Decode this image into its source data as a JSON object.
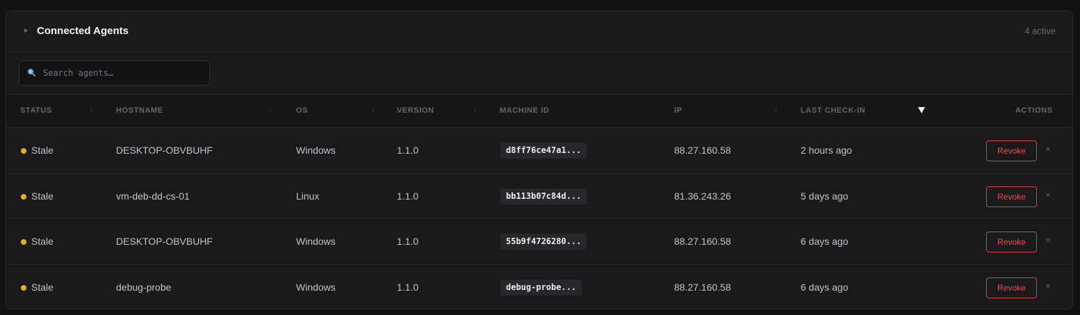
{
  "panel": {
    "title": "Connected Agents",
    "active_count": "4 active"
  },
  "search": {
    "placeholder": "Search agents…",
    "value": ""
  },
  "table": {
    "columns": [
      "STATUS",
      "HOSTNAME",
      "OS",
      "VERSION",
      "MACHINE ID",
      "IP",
      "LAST CHECK-IN",
      "ACTIONS"
    ],
    "sorted_column": "LAST CHECK-IN",
    "sort_direction": "descending",
    "rows": [
      {
        "status": "Stale",
        "hostname": "DESKTOP-OBVBUHF",
        "os": "Windows",
        "version": "1.1.0",
        "machine_id": "d8ff76ce47a1...",
        "ip": "88.27.160.58",
        "last_checkin": "2 hours ago",
        "action": "Revoke",
        "remove": "×"
      },
      {
        "status": "Stale",
        "hostname": "vm-deb-dd-cs-01",
        "os": "Linux",
        "version": "1.1.0",
        "machine_id": "bb113b07c84d...",
        "ip": "81.36.243.26",
        "last_checkin": "5 days ago",
        "action": "Revoke",
        "remove": "×"
      },
      {
        "status": "Stale",
        "hostname": "DESKTOP-OBVBUHF",
        "os": "Windows",
        "version": "1.1.0",
        "machine_id": "55b9f4726280...",
        "ip": "88.27.160.58",
        "last_checkin": "6 days ago",
        "action": "Revoke",
        "remove": "×"
      },
      {
        "status": "Stale",
        "hostname": "debug-probe",
        "os": "Windows",
        "version": "1.1.0",
        "machine_id": "debug-probe...",
        "ip": "88.27.160.58",
        "last_checkin": "6 days ago",
        "action": "Revoke",
        "remove": "×"
      }
    ]
  },
  "icons": {
    "collapse": "caret-right-icon",
    "search": "magnifier-icon",
    "sort": "sort-icon",
    "sort_active": "sort-desc-icon",
    "remove": "close-icon"
  },
  "colors": {
    "stale": "#eab308",
    "revoke": "#e5534b",
    "search_icon": "#4aa3df"
  }
}
